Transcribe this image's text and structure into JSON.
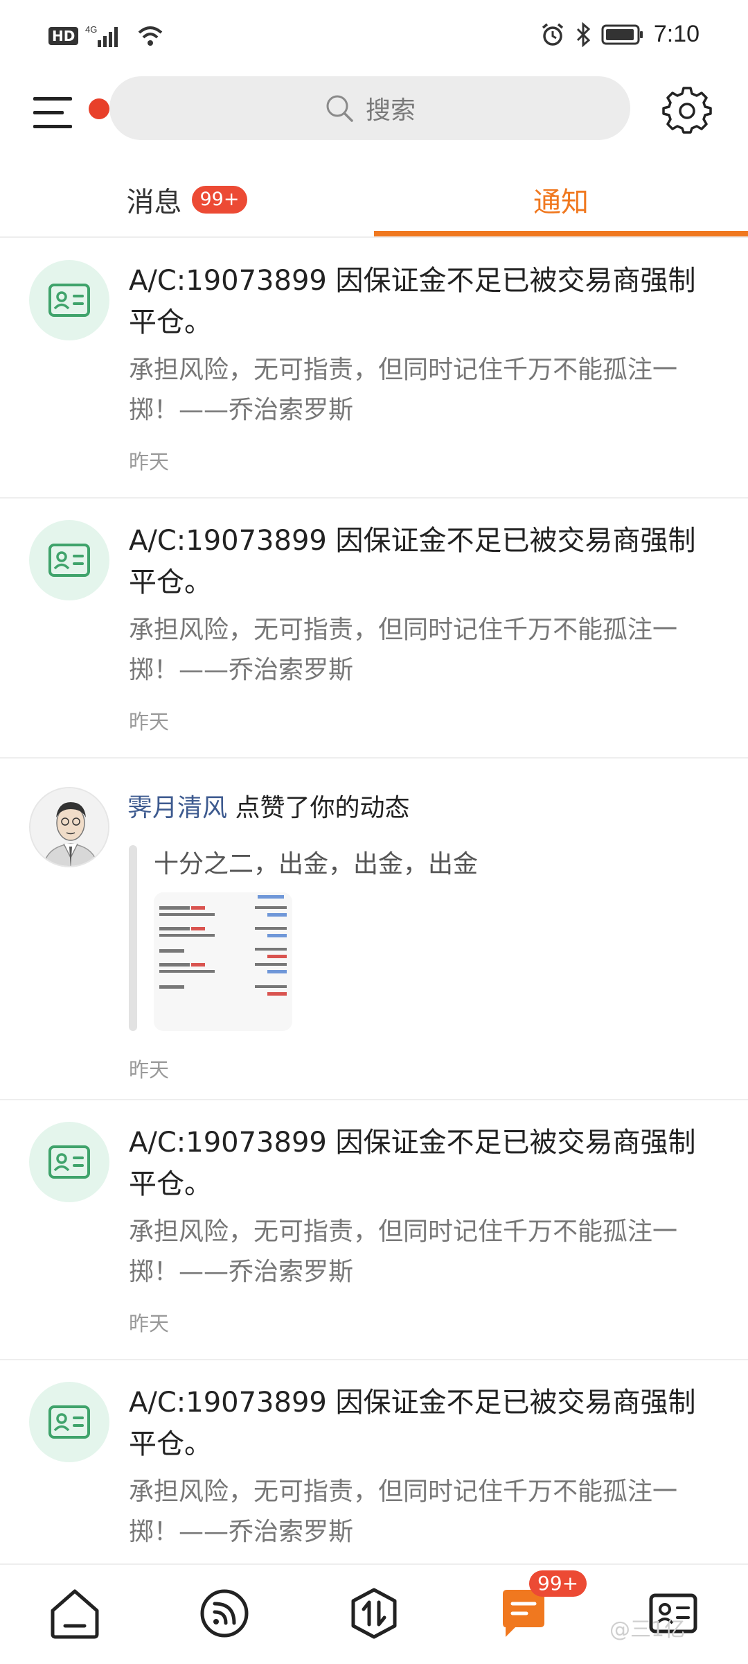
{
  "status_bar": {
    "hd": "HD",
    "network": "4G",
    "time": "7:10"
  },
  "header": {
    "search_placeholder": "搜索"
  },
  "tabs": [
    {
      "label": "消息",
      "badge": "99+"
    },
    {
      "label": "通知"
    }
  ],
  "notifications": [
    {
      "title": "A/C:19073899 因保证金不足已被交易商强制平仓。",
      "body": "承担风险，无可指责，但同时记住千万不能孤注一掷！——乔治索罗斯",
      "time": "昨天"
    },
    {
      "title": "A/C:19073899 因保证金不足已被交易商强制平仓。",
      "body": "承担风险，无可指责，但同时记住千万不能孤注一掷！——乔治索罗斯",
      "time": "昨天"
    },
    {
      "user": "霁月清风",
      "action": "点赞了你的动态",
      "quote": "十分之二，出金，出金，出金",
      "time": "昨天"
    },
    {
      "title": "A/C:19073899 因保证金不足已被交易商强制平仓。",
      "body": "承担风险，无可指责，但同时记住千万不能孤注一掷！——乔治索罗斯",
      "time": "昨天"
    },
    {
      "title": "A/C:19073899 因保证金不足已被交易商强制平仓。",
      "body": "承担风险，无可指责，但同时记住千万不能孤注一掷！——乔治索罗斯",
      "time": ""
    }
  ],
  "bottom_nav": {
    "items": [
      "home-icon",
      "feed-icon",
      "trade-icon",
      "messages-icon",
      "profile-card-icon"
    ],
    "messages_badge": "99+",
    "watermark": "@三1亿"
  },
  "colors": {
    "accent": "#f0781f",
    "badge": "#ec4a34",
    "icon_green": "#3fa36b",
    "icon_bg": "#e4f5ec",
    "username": "#3d5a8f"
  }
}
